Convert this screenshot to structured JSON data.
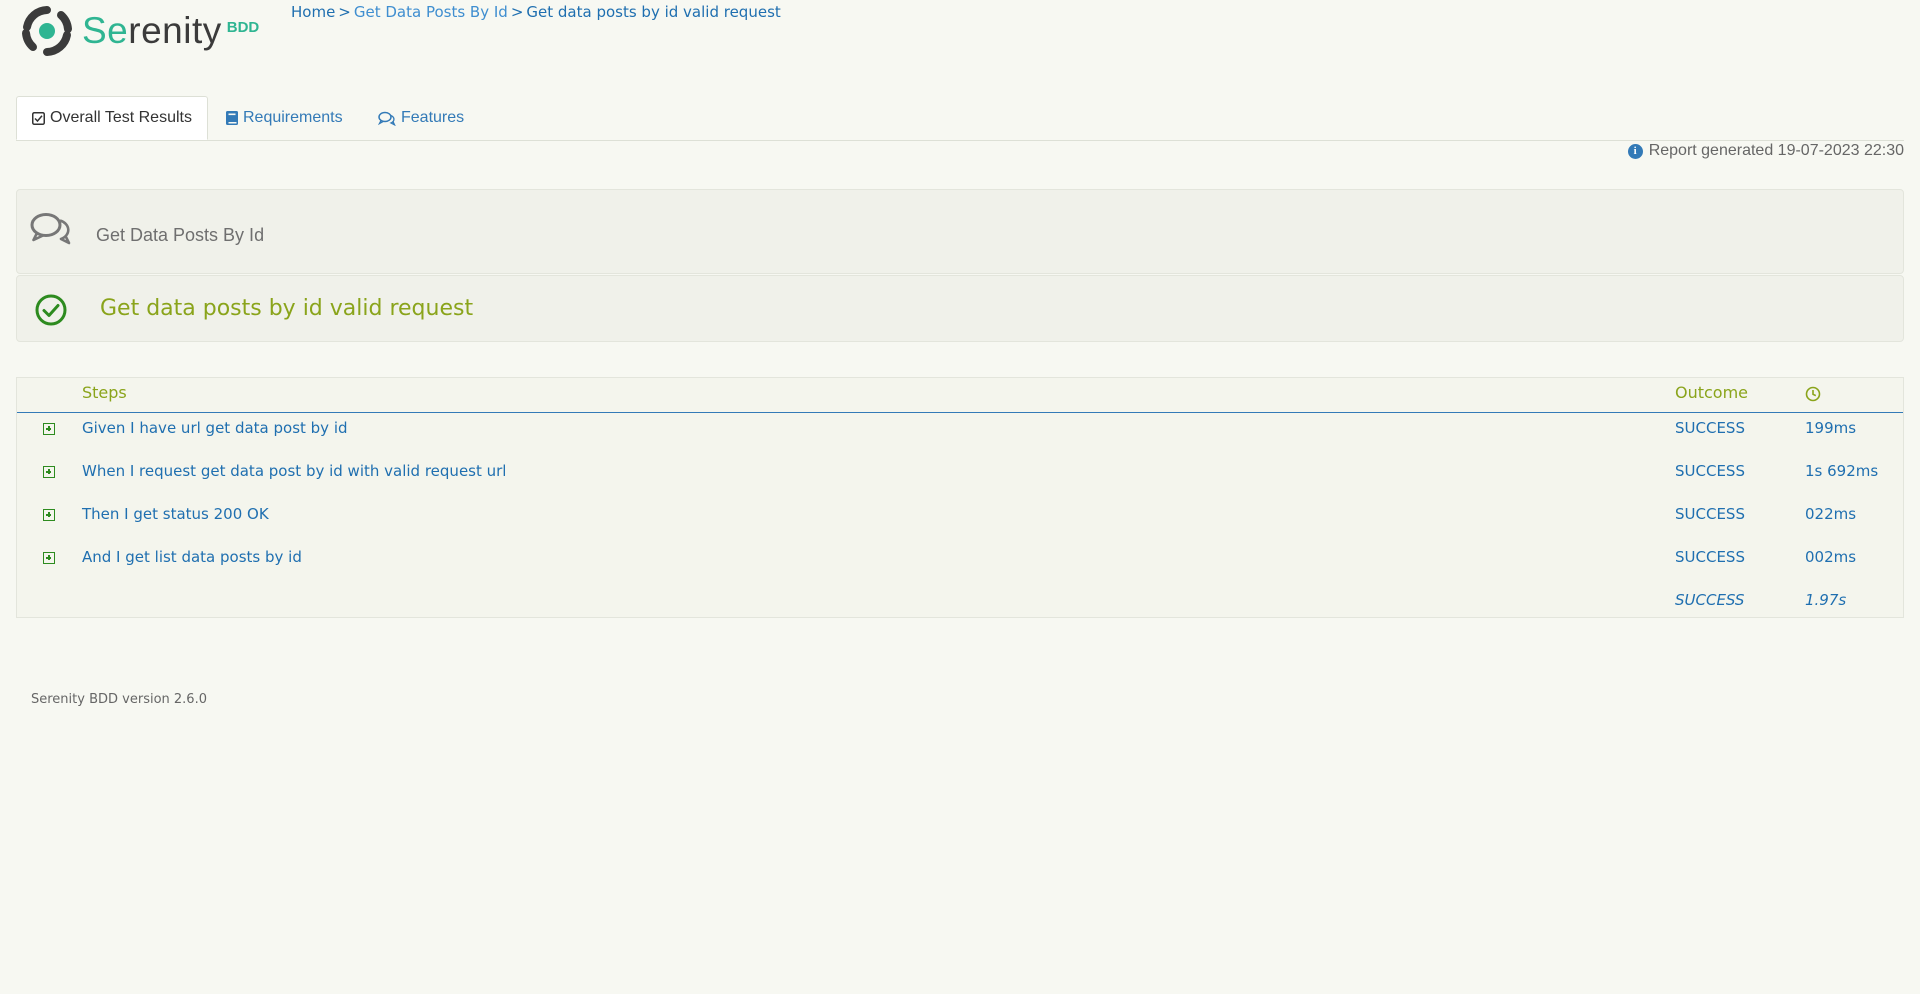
{
  "header": {
    "logo": {
      "prefix": "Se",
      "rest": "renity",
      "suffix": "BDD"
    },
    "breadcrumb": [
      "Home",
      "Get Data Posts By Id",
      "Get data posts by id valid request"
    ],
    "breadcrumb_sep": ">"
  },
  "tabs": [
    {
      "label": "Overall Test Results",
      "icon": "check-square-icon",
      "active": true
    },
    {
      "label": "Requirements",
      "icon": "book-icon",
      "active": false
    },
    {
      "label": "Features",
      "icon": "comments-icon",
      "active": false
    }
  ],
  "report": {
    "generated": "Report generated 19-07-2023 22:30",
    "icon": "info-icon"
  },
  "feature": {
    "title": "Get Data Posts By Id",
    "icon": "comments-icon"
  },
  "scenario": {
    "title": "Get data posts by id valid request",
    "status_icon": "check-circle-icon",
    "status_color": "#2d8b1f"
  },
  "steps_table": {
    "headers": {
      "steps": "Steps",
      "outcome": "Outcome",
      "duration_icon": "clock-icon"
    },
    "rows": [
      {
        "description": "Given I have url get data post by id",
        "outcome": "SUCCESS",
        "duration": "199ms"
      },
      {
        "description": "When I request get data post by id with valid request url",
        "outcome": "SUCCESS",
        "duration": "1s 692ms"
      },
      {
        "description": "Then I get status 200 OK",
        "outcome": "SUCCESS",
        "duration": "022ms"
      },
      {
        "description": "And I get list data posts by id",
        "outcome": "SUCCESS",
        "duration": "002ms"
      }
    ],
    "total": {
      "outcome": "SUCCESS",
      "duration": "1.97s"
    }
  },
  "footer": {
    "version": "Serenity BDD version 2.6.0"
  },
  "colors": {
    "accent": "#337ab7",
    "success": "#8aa41b",
    "brand": "#2fb592"
  }
}
